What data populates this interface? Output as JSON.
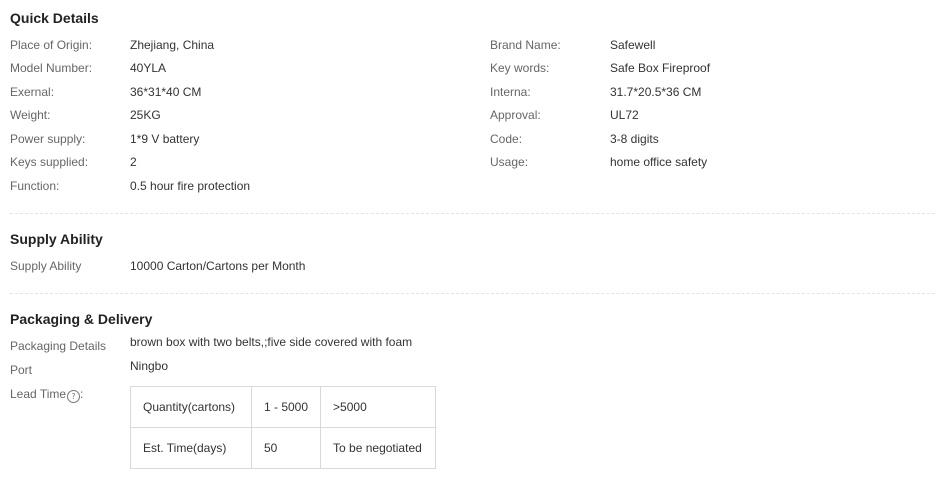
{
  "quick_details": {
    "title": "Quick Details",
    "left": [
      {
        "label": "Place of Origin:",
        "value": "Zhejiang, China"
      },
      {
        "label": "Model Number:",
        "value": "40YLA"
      },
      {
        "label": "Exernal:",
        "value": "36*31*40 CM"
      },
      {
        "label": "Weight:",
        "value": "25KG"
      },
      {
        "label": "Power supply:",
        "value": "1*9 V battery"
      },
      {
        "label": "Keys supplied:",
        "value": "2"
      },
      {
        "label": "Function:",
        "value": "0.5 hour fire protection"
      }
    ],
    "right": [
      {
        "label": "Brand Name:",
        "value": "Safewell"
      },
      {
        "label": "Key words:",
        "value": "Safe Box Fireproof"
      },
      {
        "label": "Interna:",
        "value": "31.7*20.5*36 CM"
      },
      {
        "label": "Approval:",
        "value": "UL72"
      },
      {
        "label": "Code:",
        "value": "3-8 digits"
      },
      {
        "label": "Usage:",
        "value": "home office safety"
      }
    ]
  },
  "supply": {
    "title": "Supply Ability",
    "label": "Supply Ability",
    "value": "10000 Carton/Cartons per Month"
  },
  "packaging": {
    "title": "Packaging & Delivery",
    "details_label": "Packaging Details",
    "details_value": "brown box with two belts,;five side covered with foam",
    "port_label": "Port",
    "port_value": "Ningbo",
    "lead_label": "Lead Time",
    "lead_suffix": ":",
    "help_icon": "?",
    "lead_table": {
      "row1": [
        "Quantity(cartons)",
        "1 - 5000",
        ">5000"
      ],
      "row2": [
        "Est. Time(days)",
        "50",
        "To be negotiated"
      ]
    }
  }
}
